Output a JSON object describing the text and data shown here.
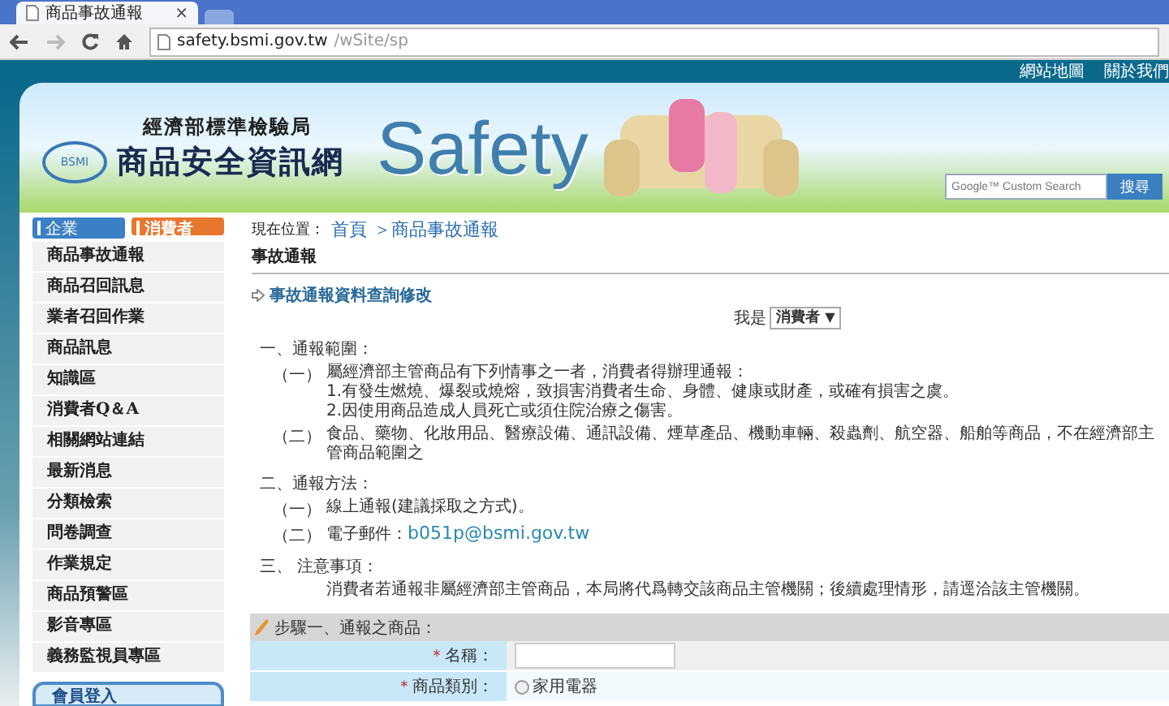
{
  "browser": {
    "tab_title": "商品事故通報",
    "tab_close": "×",
    "url_host": "safety.bsmi.gov.tw",
    "url_path": "/wSite/sp"
  },
  "top_links": [
    "網站地圖",
    "關於我們"
  ],
  "banner": {
    "agency": "經濟部標準檢驗局",
    "site_name": "商品安全資訊網",
    "logo_text": "BSMI",
    "big_word": "Safety",
    "search": {
      "placeholder": "Google™ Custom Search"
    },
    "search_button": "搜尋"
  },
  "audience_tabs": [
    {
      "label": "企業",
      "selected": false,
      "color": "#3b7fc4"
    },
    {
      "label": "消費者",
      "selected": true,
      "color": "#e8772e"
    }
  ],
  "sidebar": {
    "items": [
      "商品事故通報",
      "商品召回訊息",
      "業者召回作業",
      "商品訊息",
      "知識區",
      "消費者Q＆A",
      "相關網站連結",
      "最新消息",
      "分類檢索",
      "問卷調查",
      "作業規定",
      "商品預警區",
      "影音專區",
      "義務監視員專區"
    ],
    "login_button": "會員登入"
  },
  "breadcrumb": {
    "label": "現在位置：",
    "items": [
      "首頁",
      "＞商品事故通報"
    ]
  },
  "page_title": "事故通報",
  "query_link": "事故通報資料查詢修改",
  "role": {
    "label": "我是",
    "value": "消費者",
    "caret": "▼"
  },
  "sections": [
    {
      "heading": "一、通報範圍：",
      "items": [
        {
          "num": "（一）",
          "lines": [
            "屬經濟部主管商品有下列情事之一者，消費者得辦理通報：",
            "1.有發生燃燒、爆裂或燒熔，致損害消費者生命、身體、健康或財產，或確有損害之虞。",
            "2.因使用商品造成人員死亡或須住院治療之傷害。"
          ]
        },
        {
          "num": "（二）",
          "lines": [
            "食品、藥物、化妝用品、醫療設備、通訊設備、煙草產品、機動車輛、殺蟲劑、航空器、船舶等商品，不在經濟部主管商品範圍之"
          ]
        }
      ]
    },
    {
      "heading": "二、通報方法：",
      "items": [
        {
          "num": "（一）",
          "lines": [
            "線上通報(建議採取之方式)。"
          ]
        },
        {
          "num": "（二）",
          "lines": [
            "電子郵件："
          ],
          "email": "b051p@bsmi.gov.tw"
        }
      ]
    },
    {
      "heading": "三、 注意事項：",
      "items": [
        {
          "lines": [
            "消費者若通報非屬經濟部主管商品，本局將代爲轉交該商品主管機關；後續處理情形，請逕洽該主管機關。"
          ]
        }
      ]
    }
  ],
  "form": {
    "step_title": "步驟一、通報之商品：",
    "rows": [
      {
        "kind": "text",
        "required": "＊",
        "label": "名稱：",
        "value": ""
      },
      {
        "kind": "radio",
        "required": "＊",
        "label": "商品類別：",
        "options": [
          {
            "label": "家用電器",
            "selected": false
          }
        ]
      }
    ]
  }
}
